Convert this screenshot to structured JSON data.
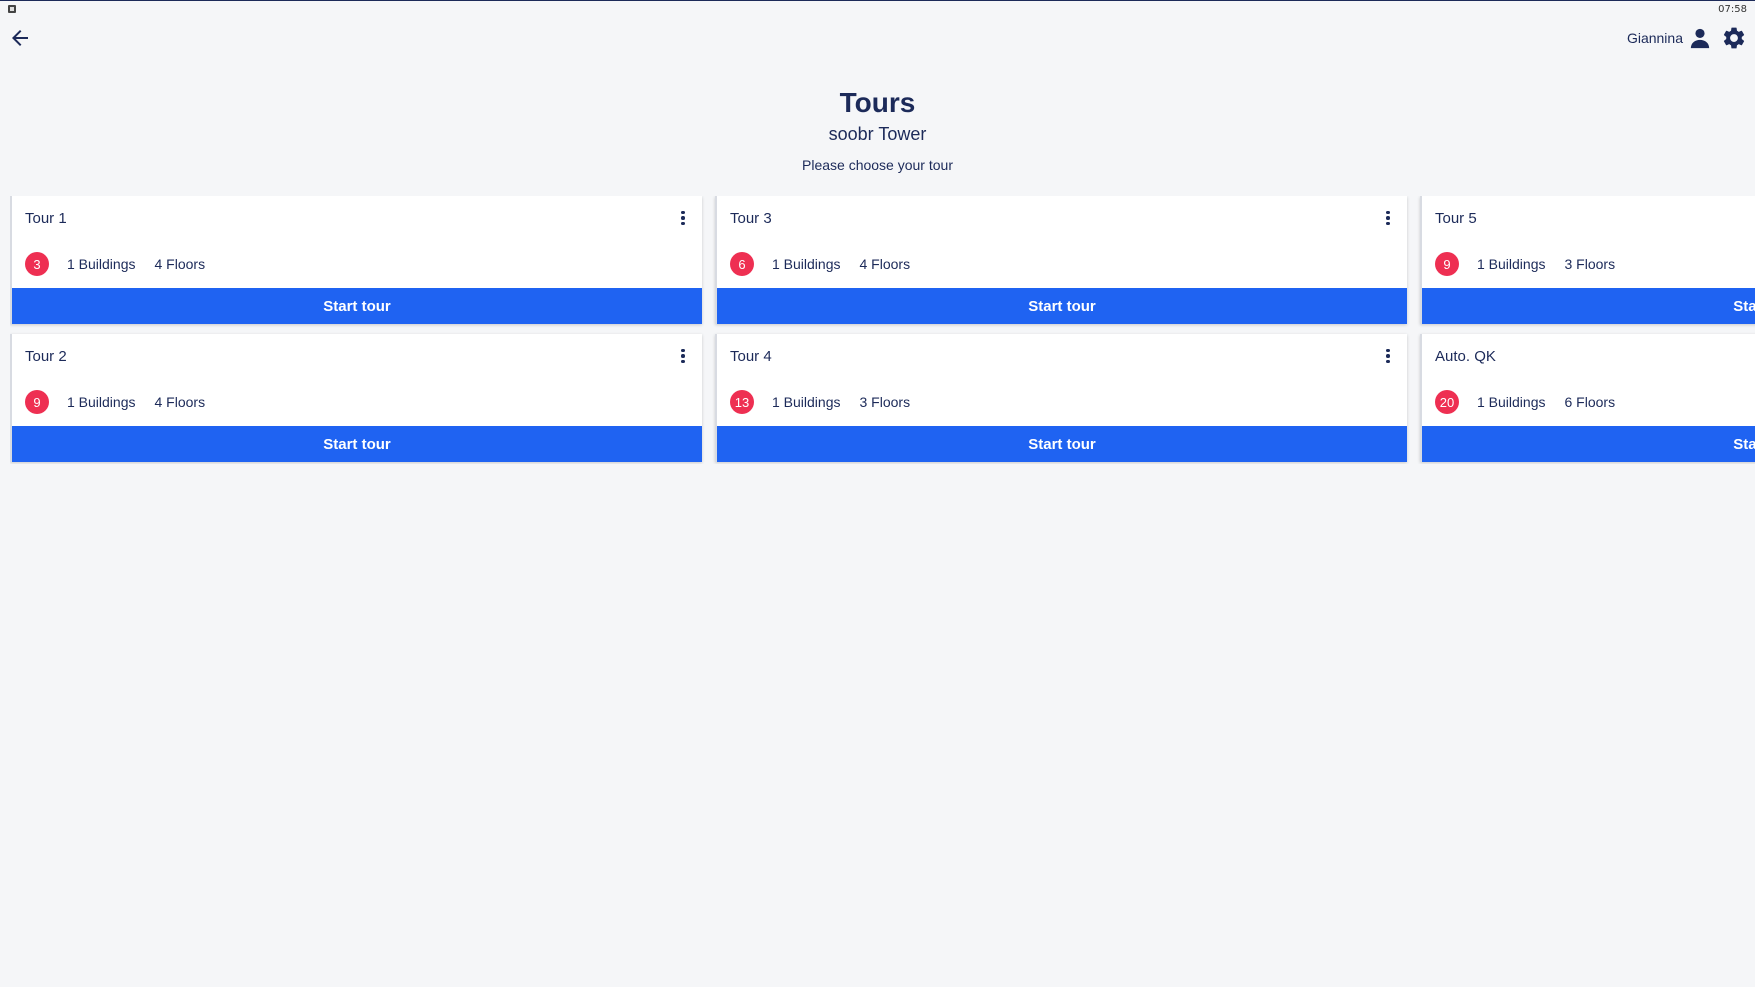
{
  "status_bar": {
    "time": "07:58",
    "app_icon": "android-app-icon"
  },
  "top_bar": {
    "back_icon": "arrow-left-icon",
    "user_name": "Giannina",
    "user_icon": "person-icon",
    "settings_icon": "gear-icon"
  },
  "header": {
    "title": "Tours",
    "subtitle": "soobr Tower",
    "hint": "Please choose your tour"
  },
  "colors": {
    "primary": "#1f63f2",
    "text": "#1c2a59",
    "badge": "#ee2f52",
    "background": "#f5f6f8"
  },
  "tours": [
    {
      "name": "Tour 1",
      "count": "3",
      "buildings": "1 Buildings",
      "floors": "4 Floors",
      "button": "Start tour"
    },
    {
      "name": "Tour 2",
      "count": "9",
      "buildings": "1 Buildings",
      "floors": "4 Floors",
      "button": "Start tour"
    },
    {
      "name": "Tour 3",
      "count": "6",
      "buildings": "1 Buildings",
      "floors": "4 Floors",
      "button": "Start tour"
    },
    {
      "name": "Tour 4",
      "count": "13",
      "buildings": "1 Buildings",
      "floors": "3 Floors",
      "button": "Start tour"
    },
    {
      "name": "Tour 5",
      "count": "9",
      "buildings": "1 Buildings",
      "floors": "3 Floors",
      "button": "Start tour"
    },
    {
      "name": "Auto. QK",
      "count": "20",
      "buildings": "1 Buildings",
      "floors": "6 Floors",
      "button": "Start tour"
    }
  ]
}
